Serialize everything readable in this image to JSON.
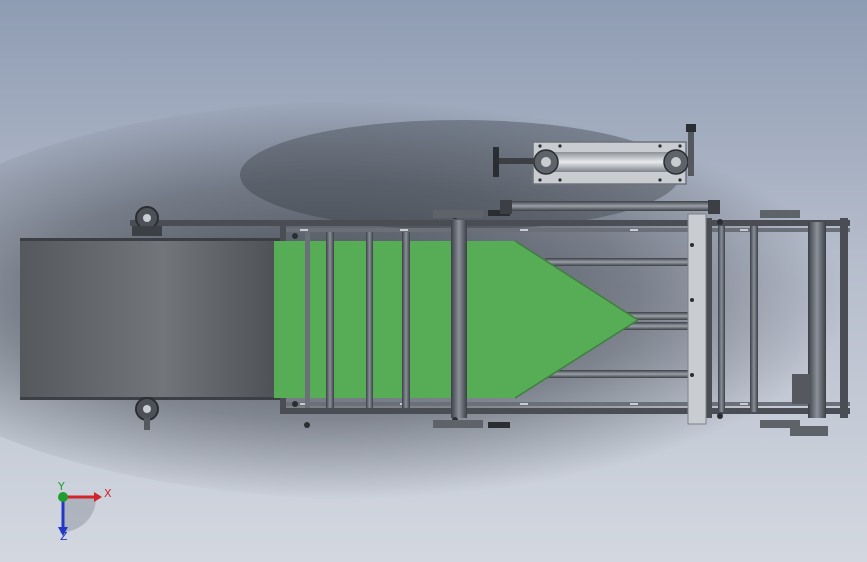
{
  "viewport": {
    "background_top": "#8e9cb3",
    "background_mid": "#b5bccb",
    "background_bottom": "#d3d8e0",
    "shadow_color": "#2e333a"
  },
  "model": {
    "belt_color": "#5c5f63",
    "feeder_color": "#56ad56",
    "frame_color": "#4a4e54",
    "roller_color": "#6b7078",
    "steel_color": "#c9ccd1"
  },
  "triad": {
    "x_label": "X",
    "y_label": "Y",
    "z_label": "Z",
    "x_color": "#d0262b",
    "y_color": "#1f9d2f",
    "z_color": "#2436c8"
  }
}
